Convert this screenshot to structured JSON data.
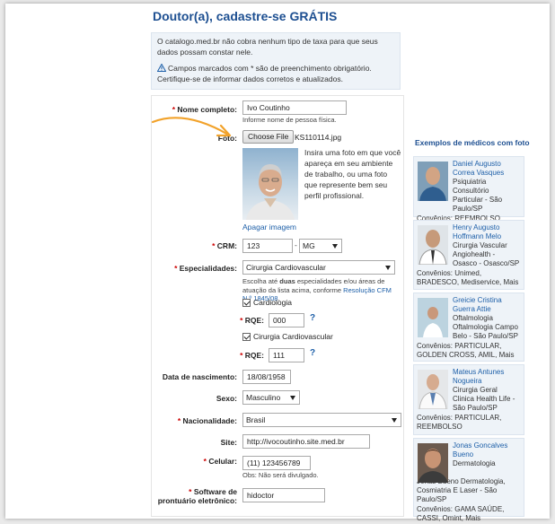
{
  "title": "Doutor(a), cadastre-se GRÁTIS",
  "info": {
    "line1": "O catalogo.med.br não cobra nenhum tipo de taxa para que seus dados possam constar nele.",
    "line2": "Campos marcados com * são de preenchimento obrigatório. Certifique-se de informar dados corretos e atualizados."
  },
  "form": {
    "nome_label": "Nome completo:",
    "nome_value": "Ivo Coutinho",
    "nome_hint": "Informe nome de pessoa física.",
    "foto_label": "Foto:",
    "choose_file": "Choose File",
    "file_name": "KS110114.jpg",
    "foto_text": "Insira uma foto em que você apareça em seu ambiente de trabalho, ou uma foto que represente bem seu perfil profissional.",
    "apagar": "Apagar imagem",
    "crm_label": "CRM:",
    "crm_value": "123",
    "crm_sep": "-",
    "crm_uf": "MG",
    "esp_label": "Especialidades:",
    "esp_value": "Cirurgia Cardiovascular",
    "esp_hint_pre": "Escolha até ",
    "esp_hint_bold": "duas",
    "esp_hint_mid": " especialidades e/ou áreas de atuação da lista acima, conforme ",
    "esp_hint_link": "Resolução CFM N.º 1845/08",
    "esp_hint_end": ".",
    "chk1": "Cardiologia",
    "rqe_label": "RQE:",
    "rqe1": "000",
    "chk2": "Cirurgia Cardiovascular",
    "rqe2": "111",
    "q": "?",
    "nasc_label": "Data de nascimento:",
    "nasc_value": "18/08/1958",
    "sexo_label": "Sexo:",
    "sexo_value": "Masculino",
    "nac_label": "Nacionalidade:",
    "nac_value": "Brasil",
    "site_label": "Site:",
    "site_value": "http://ivocoutinho.site.med.br",
    "cel_label": "Celular:",
    "cel_value": "(11) 123456789",
    "cel_hint": "Obs: Não será divulgado.",
    "soft_label1": "Software de",
    "soft_label2": "prontuário eletrônico:",
    "soft_value": "hidoctor"
  },
  "sidebar": {
    "title": "Exemplos de médicos com foto",
    "doctors": [
      {
        "name": "Daniel Augusto Correa Vasques",
        "lines": [
          "Psiquiatria",
          "Consultório Particular - São Paulo/SP"
        ],
        "conv": "Convênios: REEMBOLSO"
      },
      {
        "name": "Henry Augusto Hoffmann Melo",
        "lines": [
          "Cirurgia Vascular",
          "Angiohealth - Osasco - Osasco/SP"
        ],
        "conv": "Convênios: Unimed, BRADESCO, Mediservice, Mais"
      },
      {
        "name": "Greicie Cristina Guerra Attie",
        "lines": [
          "Oftalmologia",
          "Oftalmologia Campo Belo - São Paulo/SP"
        ],
        "conv": "Convênios: PARTICULAR, GOLDEN CROSS, AMIL, Mais"
      },
      {
        "name": "Mateus Antunes Nogueira",
        "lines": [
          "Cirurgia Geral",
          "Clinica Health Life - São Paulo/SP"
        ],
        "conv": "Convênios: PARTICULAR, REEMBOLSO"
      },
      {
        "name": "Jonas Goncalves Bueno",
        "lines": [
          "Dermatologia",
          "Jonas Bueno Dermatologia, Cosmiatria E Laser - São Paulo/SP"
        ],
        "conv": "Convênios: GAMA SAÚDE, CASSI, Omint, Mais"
      }
    ]
  }
}
